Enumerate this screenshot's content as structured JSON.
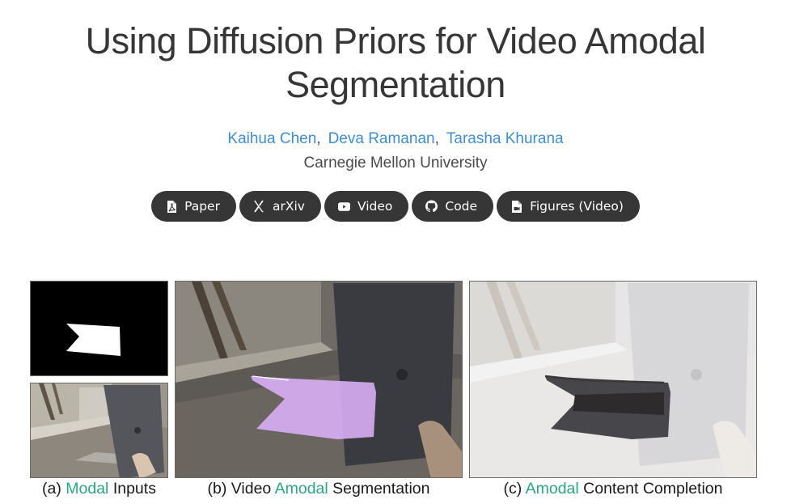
{
  "header": {
    "title_line1": "Using Diffusion Priors for Video Amodal",
    "title_line2": "Segmentation",
    "authors": [
      {
        "name": "Kaihua Chen",
        "sep": ","
      },
      {
        "name": "Deva Ramanan",
        "sep": ","
      },
      {
        "name": "Tarasha Khurana",
        "sep": ""
      }
    ],
    "affiliation": "Carnegie Mellon University"
  },
  "links": [
    {
      "label": "Paper",
      "icon": "pdf-file-icon"
    },
    {
      "label": "arXiv",
      "icon": "arxiv-icon"
    },
    {
      "label": "Video",
      "icon": "youtube-icon"
    },
    {
      "label": "Code",
      "icon": "github-icon"
    },
    {
      "label": "Figures (Video)",
      "icon": "video-file-icon"
    }
  ],
  "figure": {
    "captions": [
      {
        "prefix": "(a) ",
        "highlight": "Modal",
        "suffix": " Inputs"
      },
      {
        "prefix": "(b) Video ",
        "highlight": "Amodal",
        "suffix": " Segmentation"
      },
      {
        "prefix": "(c) ",
        "highlight": "Amodal",
        "suffix": " Content Completion"
      }
    ],
    "colors": {
      "highlight": "#2aa77f",
      "mask_overlay": "#d9aef5",
      "author_link": "#3e8ed0",
      "button_bg": "#363636"
    }
  }
}
